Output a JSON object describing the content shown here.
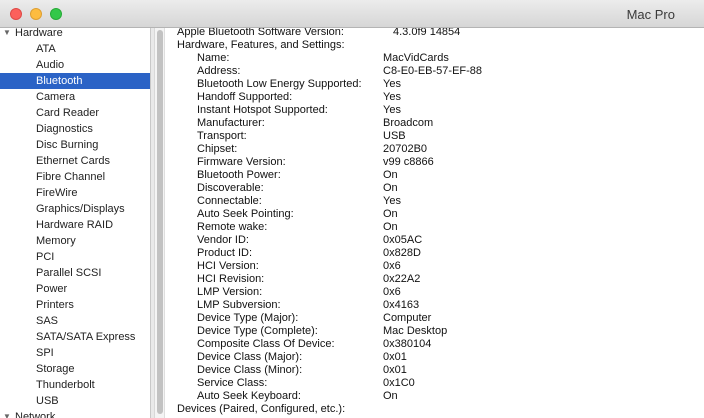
{
  "window": {
    "title": "Mac Pro"
  },
  "sidebar": {
    "groups": [
      {
        "label": "Hardware",
        "expanded": true
      },
      {
        "label": "Network",
        "expanded": true
      }
    ],
    "items": [
      {
        "label": "ATA"
      },
      {
        "label": "Audio"
      },
      {
        "label": "Bluetooth",
        "selected": true
      },
      {
        "label": "Camera"
      },
      {
        "label": "Card Reader"
      },
      {
        "label": "Diagnostics"
      },
      {
        "label": "Disc Burning"
      },
      {
        "label": "Ethernet Cards"
      },
      {
        "label": "Fibre Channel"
      },
      {
        "label": "FireWire"
      },
      {
        "label": "Graphics/Displays"
      },
      {
        "label": "Hardware RAID"
      },
      {
        "label": "Memory"
      },
      {
        "label": "PCI"
      },
      {
        "label": "Parallel SCSI"
      },
      {
        "label": "Power"
      },
      {
        "label": "Printers"
      },
      {
        "label": "SAS"
      },
      {
        "label": "SATA/SATA Express"
      },
      {
        "label": "SPI"
      },
      {
        "label": "Storage"
      },
      {
        "label": "Thunderbolt"
      },
      {
        "label": "USB"
      }
    ]
  },
  "content": {
    "software_version_label": "Apple Bluetooth Software Version:",
    "software_version_value": "4.3.0f9 14854",
    "section_header": "Hardware, Features, and Settings:",
    "properties": [
      {
        "label": "Name:",
        "value": "MacVidCards"
      },
      {
        "label": "Address:",
        "value": "C8-E0-EB-57-EF-88"
      },
      {
        "label": "Bluetooth Low Energy Supported:",
        "value": "Yes"
      },
      {
        "label": "Handoff Supported:",
        "value": "Yes"
      },
      {
        "label": "Instant Hotspot Supported:",
        "value": "Yes"
      },
      {
        "label": "Manufacturer:",
        "value": "Broadcom"
      },
      {
        "label": "Transport:",
        "value": "USB"
      },
      {
        "label": "Chipset:",
        "value": "20702B0"
      },
      {
        "label": "Firmware Version:",
        "value": "v99 c8866"
      },
      {
        "label": "Bluetooth Power:",
        "value": "On"
      },
      {
        "label": "Discoverable:",
        "value": "On"
      },
      {
        "label": "Connectable:",
        "value": "Yes"
      },
      {
        "label": "Auto Seek Pointing:",
        "value": "On"
      },
      {
        "label": "Remote wake:",
        "value": "On"
      },
      {
        "label": "Vendor ID:",
        "value": "0x05AC"
      },
      {
        "label": "Product ID:",
        "value": "0x828D"
      },
      {
        "label": "HCI Version:",
        "value": "0x6"
      },
      {
        "label": "HCI Revision:",
        "value": "0x22A2"
      },
      {
        "label": "LMP Version:",
        "value": "0x6"
      },
      {
        "label": "LMP Subversion:",
        "value": "0x4163"
      },
      {
        "label": "Device Type (Major):",
        "value": "Computer"
      },
      {
        "label": "Device Type (Complete):",
        "value": "Mac Desktop"
      },
      {
        "label": "Composite Class Of Device:",
        "value": "0x380104"
      },
      {
        "label": "Device Class (Major):",
        "value": "0x01"
      },
      {
        "label": "Device Class (Minor):",
        "value": "0x01"
      },
      {
        "label": "Service Class:",
        "value": "0x1C0"
      },
      {
        "label": "Auto Seek Keyboard:",
        "value": "On"
      }
    ],
    "devices_header": "Devices (Paired, Configured, etc.):"
  },
  "colors": {
    "selection": "#2b63c6"
  }
}
